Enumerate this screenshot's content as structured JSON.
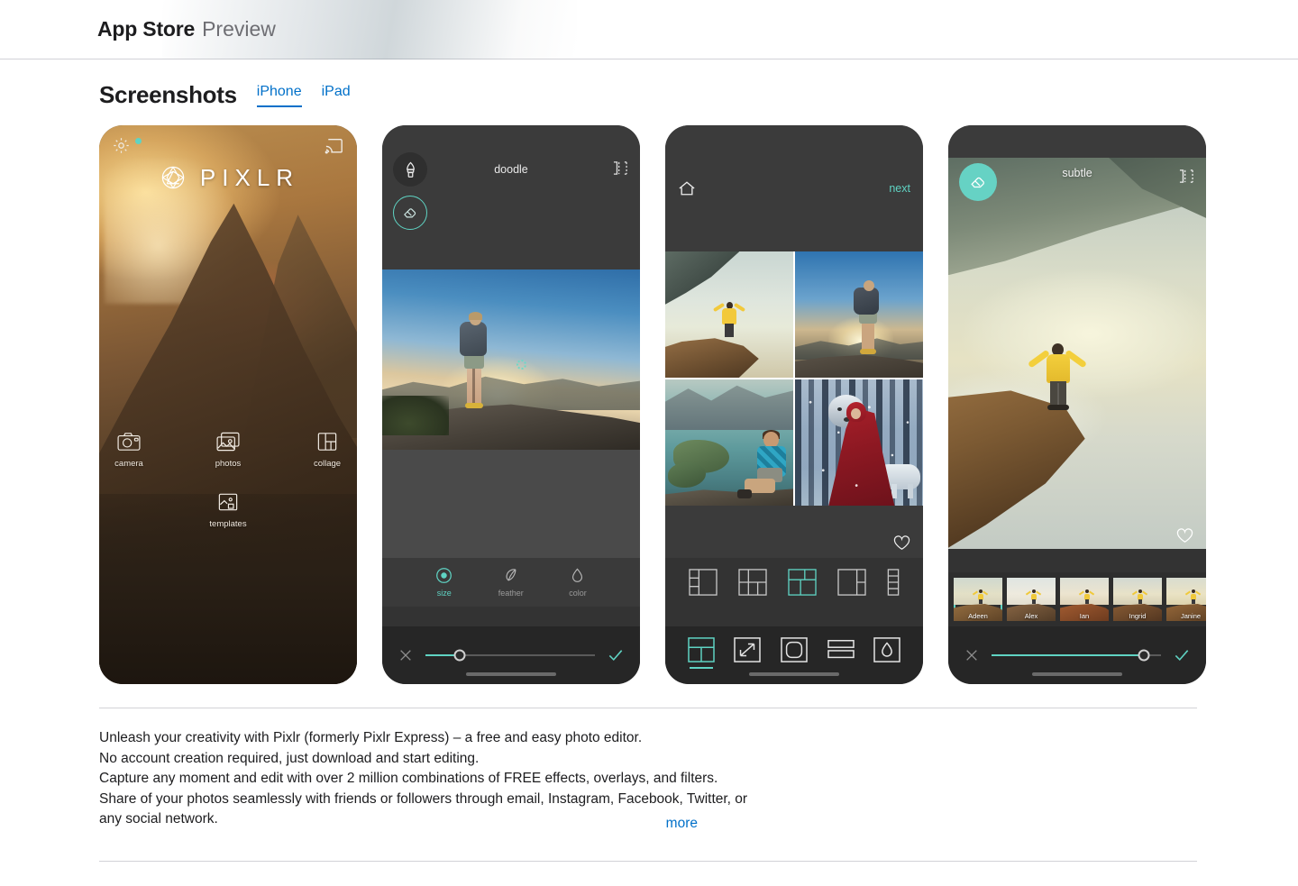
{
  "header": {
    "title": "App Store",
    "subtitle": "Preview"
  },
  "screenshots_section": {
    "title": "Screenshots",
    "tabs": [
      {
        "label": "iPhone",
        "active": true
      },
      {
        "label": "iPad",
        "active": false
      }
    ]
  },
  "accent": {
    "teal": "#5fd3c3",
    "link_blue": "#0070c9",
    "dark_chrome": "#3b3b3b",
    "toolbar_dark": "#262626"
  },
  "phone1": {
    "name": "pixlr-home-splash",
    "brand": "PIXLR",
    "icons": {
      "settings": "gear-icon",
      "settings_badge": "teal-dot",
      "cast": "cast-icon",
      "logo": "aperture-icon"
    },
    "menu": [
      {
        "label": "camera",
        "icon": "camera-icon"
      },
      {
        "label": "photos",
        "icon": "photos-icon"
      },
      {
        "label": "collage",
        "icon": "collage-icon"
      },
      {
        "label": "templates",
        "icon": "templates-icon"
      }
    ]
  },
  "phone2": {
    "name": "doodle-editor",
    "title": "doodle",
    "compare_icon": "compare-icon",
    "tools": [
      {
        "name": "brush-tool",
        "icon": "brush-icon",
        "selected": false
      },
      {
        "name": "eraser-tool",
        "icon": "eraser-icon",
        "selected": true
      }
    ],
    "tabs": [
      {
        "label": "size",
        "icon": "size-icon",
        "active": true
      },
      {
        "label": "feather",
        "icon": "feather-icon",
        "active": false
      },
      {
        "label": "color",
        "icon": "droplet-icon",
        "active": false
      }
    ],
    "slider_value": 20,
    "cancel_icon": "close-icon",
    "confirm_icon": "check-icon"
  },
  "phone3": {
    "name": "collage-editor",
    "home_icon": "home-icon",
    "next_label": "next",
    "favorite_icon": "heart-icon",
    "photos": [
      "man-yellow-jacket-on-cliff",
      "backpacker-at-sunset",
      "man-seated-by-lake",
      "red-cloak-figure-with-wolves-in-snow"
    ],
    "layouts": [
      {
        "name": "layout-option-1",
        "selected": false
      },
      {
        "name": "layout-option-2",
        "selected": false
      },
      {
        "name": "layout-option-3",
        "selected": true
      },
      {
        "name": "layout-option-4",
        "selected": false
      },
      {
        "name": "layout-option-5",
        "selected": false
      }
    ],
    "toolbar": [
      {
        "name": "layout-tool",
        "icon": "grid-icon",
        "selected": true
      },
      {
        "name": "ratio-tool",
        "icon": "resize-arrow-icon",
        "selected": false
      },
      {
        "name": "corner-tool",
        "icon": "rounded-square-icon",
        "selected": false
      },
      {
        "name": "spacing-tool",
        "icon": "stack-rows-icon",
        "selected": false
      },
      {
        "name": "color-tool",
        "icon": "droplet-square-icon",
        "selected": false
      }
    ]
  },
  "phone4": {
    "name": "filter-editor",
    "title": "subtle",
    "eraser_icon": "eraser-icon",
    "compare_icon": "compare-icon",
    "favorite_icon": "heart-icon",
    "photo": "man-yellow-jacket-on-cliff-above-clouds",
    "filters": [
      {
        "label": "Adeen",
        "selected": true
      },
      {
        "label": "Alex",
        "selected": false
      },
      {
        "label": "Ian",
        "selected": false
      },
      {
        "label": "Ingrid",
        "selected": false
      },
      {
        "label": "Janine",
        "selected": false
      }
    ],
    "slider_value": 90,
    "cancel_icon": "close-icon",
    "confirm_icon": "check-icon"
  },
  "description": {
    "lines": [
      "Unleash your creativity with Pixlr (formerly Pixlr Express) – a free and easy photo editor.",
      "No account creation required, just download and start editing.",
      "Capture any moment and edit with over 2 million combinations of FREE effects, overlays, and filters.",
      "Share of your photos seamlessly with friends or followers through email, Instagram, Facebook, Twitter, or",
      "any social network."
    ],
    "more_label": "more"
  }
}
